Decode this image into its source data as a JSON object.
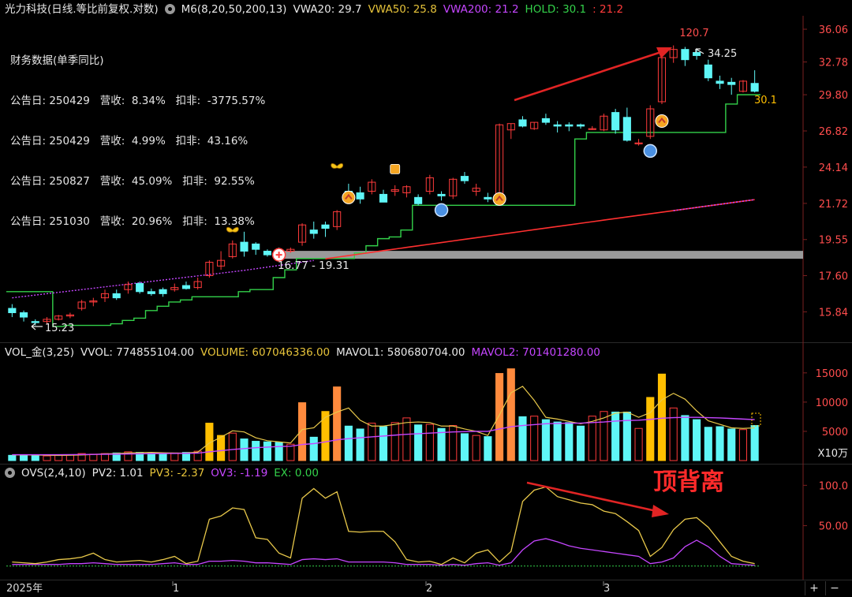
{
  "price_panel": {
    "title": "光力科技(日线.等比前复权.对数)",
    "indicator": "M6(8,20,50,200,13)",
    "vwa20": "VWA20: 29.7",
    "vwa50": "VWA50: 25.8",
    "vwa200": "VWA200: 21.2",
    "hold": "HOLD: 30.1",
    "hold2": ": 21.2",
    "fin_title": "财务数据(单季同比)",
    "fin_rows": [
      {
        "label": "公告日: 250429",
        "rev": "营收:  8.34%",
        "net": "扣非:  -3775.57%"
      },
      {
        "label": "公告日: 250429",
        "rev": "营收:  4.99%",
        "net": "扣非:  43.16%"
      },
      {
        "label": "公告日: 250827",
        "rev": "营收:  45.09%",
        "net": "扣非:  92.55%"
      },
      {
        "label": "公告日: 251030",
        "rev": "营收:  20.96%",
        "net": "扣非:  13.38%"
      }
    ],
    "ann_high": "120.7",
    "ann_peak": "34.25",
    "ann_low": "15.23",
    "ann_last": "30.1",
    "ann_band": "16.77 - 19.31",
    "y_ticks": [
      "36.06",
      "32.78",
      "29.80",
      "26.82",
      "24.14",
      "21.72",
      "19.55",
      "17.60",
      "15.84"
    ]
  },
  "volume_panel": {
    "title": "VOL_金(3,25)",
    "vvol": "VVOL: 774855104.00",
    "volume": "VOLUME: 607046336.00",
    "mavol1": "MAVOL1: 580680704.00",
    "mavol2": "MAVOL2: 701401280.00",
    "y_ticks": [
      "15000",
      "10000",
      "5000"
    ],
    "unit": "X10万"
  },
  "ovs_panel": {
    "title": "OVS(2,4,10)",
    "pv2": "PV2: 1.01",
    "pv3": "PV3: -2.37",
    "ov3": "OV3: -1.19",
    "ex": "EX: 0.00",
    "annotation": "顶背离",
    "y_ticks": [
      "100.0",
      "50.00"
    ]
  },
  "x_axis": {
    "year_label": "2025年",
    "month_labels": [
      "1",
      "2",
      "3"
    ]
  },
  "zoom": {
    "plus": "+",
    "minus": "−"
  },
  "colors": {
    "up": "#ff3b3b",
    "down": "#5ff6f7",
    "hold": "#33d14a",
    "vwa200": "#c546ff",
    "vwa_long": "#ff3030",
    "ovs": "#e8c84a",
    "ov3": "#c546ff",
    "vol_yellow": "#ffbf00",
    "vol_orange": "#ff8a3d"
  },
  "chart_data": [
    {
      "type": "candlestick",
      "title": "光力科技(日线.等比前复权.对数)",
      "ylim": [
        14.8,
        37.5
      ],
      "y_scale": "log",
      "candles": [
        [
          16.0,
          16.2,
          15.6,
          15.8
        ],
        [
          15.8,
          15.9,
          15.4,
          15.6
        ],
        [
          15.4,
          15.5,
          15.23,
          15.35
        ],
        [
          15.4,
          15.6,
          15.3,
          15.5
        ],
        [
          15.5,
          15.7,
          15.45,
          15.65
        ],
        [
          15.65,
          15.8,
          15.55,
          15.7
        ],
        [
          16.0,
          16.4,
          15.9,
          16.3
        ],
        [
          16.3,
          16.5,
          16.1,
          16.35
        ],
        [
          16.5,
          16.9,
          16.3,
          16.7
        ],
        [
          16.7,
          16.9,
          16.4,
          16.5
        ],
        [
          16.9,
          17.3,
          16.7,
          17.15
        ],
        [
          17.2,
          17.3,
          16.7,
          16.8
        ],
        [
          16.8,
          16.95,
          16.6,
          16.7
        ],
        [
          16.9,
          17.0,
          16.55,
          16.7
        ],
        [
          16.9,
          17.2,
          16.8,
          17.0
        ],
        [
          17.1,
          17.3,
          16.9,
          16.95
        ],
        [
          17.0,
          17.5,
          16.9,
          17.3
        ],
        [
          17.6,
          18.4,
          17.5,
          18.3
        ],
        [
          18.1,
          18.9,
          17.9,
          18.4
        ],
        [
          18.6,
          19.5,
          18.5,
          19.3
        ],
        [
          19.4,
          20.0,
          18.6,
          18.9
        ],
        [
          19.3,
          19.4,
          18.7,
          19.0
        ],
        [
          18.9,
          19.0,
          18.6,
          18.7
        ],
        [
          18.8,
          19.1,
          18.5,
          18.7
        ],
        [
          18.9,
          19.1,
          18.8,
          19.0
        ],
        [
          19.4,
          20.5,
          19.2,
          20.4
        ],
        [
          20.1,
          20.6,
          19.6,
          19.9
        ],
        [
          20.4,
          20.6,
          19.7,
          20.2
        ],
        [
          20.3,
          21.3,
          20.1,
          21.2
        ],
        [
          22.5,
          23.0,
          21.8,
          22.0
        ],
        [
          22.4,
          22.8,
          21.7,
          22.0
        ],
        [
          22.5,
          23.3,
          22.3,
          23.1
        ],
        [
          22.3,
          22.6,
          21.8,
          21.8
        ],
        [
          22.5,
          22.9,
          22.2,
          22.6
        ],
        [
          22.4,
          22.9,
          22.1,
          22.8
        ],
        [
          22.1,
          22.3,
          21.6,
          21.7
        ],
        [
          22.5,
          23.6,
          22.3,
          23.4
        ],
        [
          22.3,
          22.5,
          21.9,
          22.2
        ],
        [
          22.2,
          23.4,
          22.0,
          23.3
        ],
        [
          23.5,
          23.8,
          23.0,
          23.2
        ],
        [
          22.5,
          23.0,
          22.2,
          22.7
        ],
        [
          22.1,
          22.4,
          21.8,
          22.0
        ],
        [
          21.8,
          27.4,
          21.6,
          27.3
        ],
        [
          26.9,
          27.4,
          26.2,
          27.4
        ],
        [
          27.7,
          28.0,
          27.1,
          27.2
        ],
        [
          27.0,
          27.5,
          26.9,
          27.5
        ],
        [
          27.8,
          28.2,
          27.3,
          27.5
        ],
        [
          27.3,
          27.6,
          26.7,
          27.2
        ],
        [
          27.3,
          27.5,
          26.8,
          27.2
        ],
        [
          27.3,
          27.4,
          27.0,
          27.2
        ],
        [
          27.0,
          27.2,
          26.9,
          27.0
        ],
        [
          26.9,
          28.2,
          26.8,
          28.0
        ],
        [
          28.3,
          28.6,
          26.6,
          26.9
        ],
        [
          27.9,
          28.7,
          26.0,
          26.1
        ],
        [
          25.9,
          26.2,
          25.7,
          25.9
        ],
        [
          26.4,
          28.9,
          26.2,
          28.6
        ],
        [
          29.2,
          33.6,
          29.0,
          33.2
        ],
        [
          33.2,
          34.4,
          32.7,
          34.0
        ],
        [
          34.0,
          34.25,
          32.4,
          33.0
        ],
        [
          33.7,
          34.0,
          33.0,
          33.4
        ],
        [
          32.5,
          33.0,
          31.0,
          31.3
        ],
        [
          31.0,
          31.5,
          30.3,
          30.8
        ],
        [
          30.9,
          31.3,
          29.8,
          30.7
        ],
        [
          30.1,
          31.1,
          30.0,
          31.0
        ],
        [
          30.8,
          32.0,
          30.0,
          30.1
        ]
      ],
      "annotations": {
        "high": 120.7,
        "peak": 34.25,
        "low": 15.23,
        "last": 30.1,
        "band": [
          16.77,
          19.31
        ]
      }
    },
    {
      "type": "bar",
      "title": "VOL_金(3,25)",
      "unit": "X10万",
      "ylim": [
        0,
        17000
      ],
      "values": [
        900,
        1000,
        900,
        800,
        900,
        1000,
        1200,
        1100,
        1200,
        1300,
        1500,
        1400,
        1300,
        1200,
        1300,
        1400,
        1600,
        6400,
        4300,
        4700,
        3700,
        3300,
        3200,
        3100,
        2800,
        9900,
        4000,
        8400,
        12600,
        5900,
        5400,
        6400,
        5800,
        6500,
        7300,
        6100,
        6200,
        5500,
        6000,
        4600,
        4300,
        4100,
        14900,
        15700,
        7500,
        7600,
        7000,
        6600,
        6500,
        5900,
        7600,
        8400,
        8300,
        8300,
        5500,
        10800,
        14800,
        9000,
        7700,
        7000,
        5700,
        5800,
        5400,
        5300,
        6000
      ],
      "mavol1": [
        950,
        970,
        940,
        900,
        880,
        900,
        950,
        1050,
        1150,
        1200,
        1300,
        1350,
        1400,
        1330,
        1280,
        1300,
        1430,
        3000,
        4000,
        5100,
        4900,
        3900,
        3400,
        3200,
        3000,
        5300,
        5600,
        7400,
        8300,
        9000,
        6900,
        5900,
        5900,
        6200,
        6500,
        6600,
        6500,
        5900,
        5900,
        5400,
        5000,
        4300,
        7800,
        11600,
        12700,
        10300,
        7400,
        7100,
        6700,
        6300,
        6700,
        7300,
        8100,
        8300,
        7400,
        8200,
        10400,
        11500,
        10500,
        8500,
        6800,
        6200,
        5600,
        5500,
        5600
      ],
      "mavol2": [
        1000,
        1000,
        1000,
        1000,
        1000,
        1020,
        1040,
        1060,
        1080,
        1100,
        1130,
        1160,
        1180,
        1200,
        1220,
        1240,
        1270,
        1500,
        1700,
        1900,
        2050,
        2200,
        2300,
        2400,
        2450,
        2750,
        2900,
        3200,
        3550,
        3750,
        3900,
        4050,
        4200,
        4350,
        4500,
        4600,
        4700,
        4800,
        4900,
        4950,
        5000,
        5000,
        5400,
        5800,
        6000,
        6150,
        6300,
        6350,
        6400,
        6400,
        6500,
        6600,
        6750,
        6850,
        6900,
        7050,
        7250,
        7350,
        7400,
        7400,
        7350,
        7300,
        7200,
        7100,
        7010
      ]
    },
    {
      "type": "line",
      "title": "OVS(2,4,10)",
      "ylim": [
        -10,
        115
      ],
      "series": [
        {
          "name": "PV2",
          "values": [
            5,
            4,
            3,
            5,
            8,
            9,
            11,
            16,
            8,
            5,
            6,
            7,
            5,
            8,
            12,
            3,
            6,
            58,
            62,
            72,
            70,
            35,
            33,
            16,
            10,
            84,
            96,
            84,
            92,
            43,
            42,
            43,
            43,
            30,
            8,
            5,
            6,
            2,
            10,
            4,
            16,
            20,
            5,
            18,
            80,
            94,
            98,
            86,
            82,
            78,
            76,
            68,
            65,
            55,
            44,
            12,
            23,
            45,
            58,
            60,
            48,
            30,
            12,
            6,
            3
          ]
        },
        {
          "name": "OV3",
          "values": [
            2,
            2,
            2,
            2,
            2,
            3,
            3,
            4,
            3,
            2,
            2,
            2,
            2,
            3,
            4,
            2,
            2,
            6,
            6,
            7,
            6,
            4,
            4,
            3,
            2,
            8,
            9,
            8,
            9,
            5,
            5,
            5,
            5,
            4,
            2,
            2,
            2,
            1,
            2,
            1,
            3,
            4,
            1,
            4,
            20,
            31,
            34,
            30,
            25,
            22,
            20,
            18,
            16,
            14,
            12,
            3,
            5,
            10,
            24,
            32,
            24,
            12,
            3,
            2,
            1
          ]
        },
        {
          "name": "EX",
          "values": [
            0,
            0,
            0,
            0,
            0,
            0,
            0,
            0,
            0,
            0,
            0,
            0,
            0,
            0,
            0,
            0,
            0,
            0,
            0,
            0,
            0,
            0,
            0,
            0,
            0,
            0,
            0,
            0,
            0,
            0,
            0,
            0,
            0,
            0,
            0,
            0,
            0,
            0,
            0,
            0,
            0,
            0,
            0,
            0,
            0,
            0,
            0,
            0,
            0,
            0,
            0,
            0,
            0,
            0,
            0,
            0,
            0,
            0,
            0,
            0,
            0,
            0,
            0,
            0,
            0
          ]
        }
      ]
    }
  ]
}
